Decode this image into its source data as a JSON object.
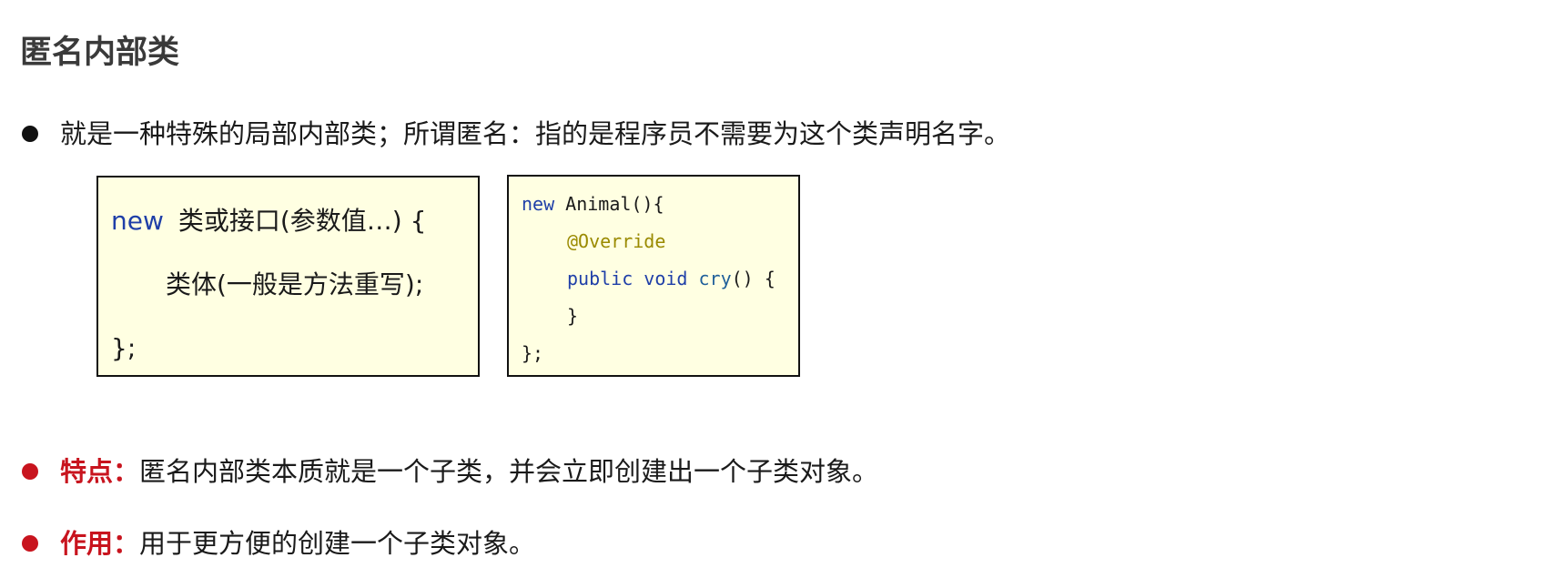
{
  "title": "匿名内部类",
  "bullets": [
    {
      "label": "",
      "text": "就是一种特殊的局部内部类；所谓匿名：指的是程序员不需要为这个类声明名字。",
      "dot_color": "#111111"
    },
    {
      "label": "特点：",
      "text": "匿名内部类本质就是一个子类，并会立即创建出一个子类对象。",
      "dot_color": "#c8141e"
    },
    {
      "label": "作用：",
      "text": "用于更方便的创建一个子类对象。",
      "dot_color": "#c8141e"
    }
  ],
  "syntax_box": {
    "keyword": "new",
    "line1": "类或接口(参数值…) {",
    "line2": "类体(一般是方法重写);",
    "line3": "};"
  },
  "code_box": {
    "line1_kw": "new",
    "line1_rest": " Animal(){",
    "line2_annotation": "@Override",
    "line3_kw": "public void",
    "line3_fn": "cry",
    "line3_rest": "() {",
    "line4": "}",
    "line5": "};"
  },
  "colors": {
    "keyword_blue": "#1f3fa8",
    "highlight_red": "#c8141e",
    "annotation_olive": "#9a8a00",
    "code_box_bg": "#ffffe2"
  }
}
